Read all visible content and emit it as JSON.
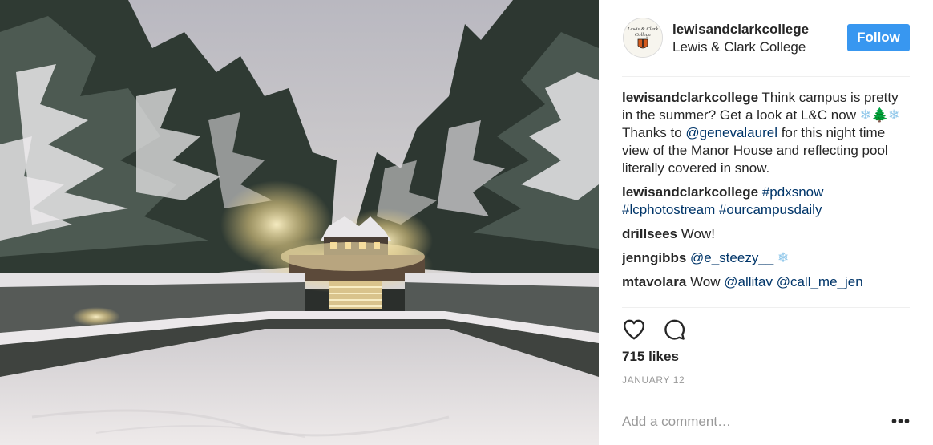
{
  "post": {
    "image_alt_icon": "photo-snowy-manor-house",
    "header": {
      "username": "lewisandclarkcollege",
      "location": "Lewis & Clark College",
      "follow_label": "Follow",
      "avatar_text_line1": "Lewis & Clark",
      "avatar_text_line2": "College"
    },
    "caption": {
      "author": "lewisandclarkcollege",
      "text_part1": " Think campus is pretty in the summer? Get a look at L&C now ",
      "emoji": "❄🌲❄",
      "text_part2": "Thanks to ",
      "mention": "@genevalaurel",
      "text_part3": " for this night time view of the Manor House and reflecting pool literally covered in snow."
    },
    "comments": [
      {
        "author": "lewisandclarkcollege",
        "hashtags": "#pdxsnow #lcphotostream #ourcampusdaily"
      },
      {
        "author": "drillsees",
        "text": "Wow!"
      },
      {
        "author": "jenngibbs",
        "mention": "@e_steezy__",
        "emoji": "❄"
      },
      {
        "author": "mtavolara",
        "text": "Wow ",
        "mentions": "@allitav @call_me_jen"
      }
    ],
    "actions": {
      "like_icon": "heart-icon",
      "comment_icon": "comment-bubble-icon"
    },
    "likes": "715 likes",
    "date": "JANUARY 12",
    "add_comment_placeholder": "Add a comment…",
    "more_label": "•••"
  },
  "colors": {
    "follow_button": "#3897f0",
    "link": "#003569",
    "muted": "#999999",
    "text": "#262626"
  }
}
